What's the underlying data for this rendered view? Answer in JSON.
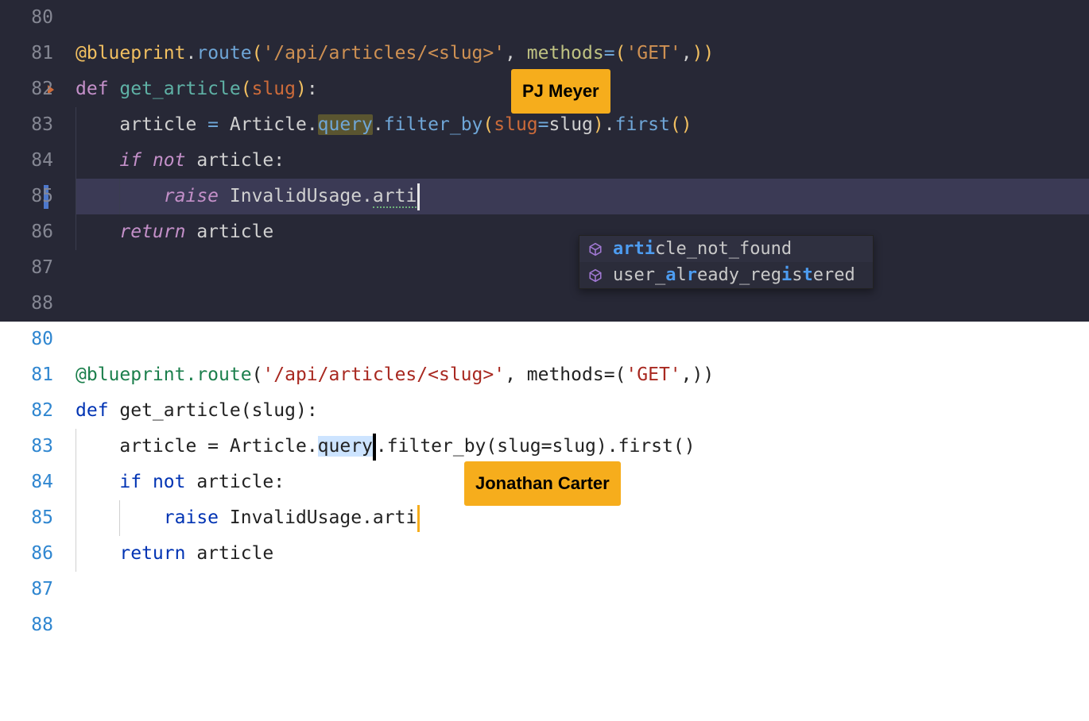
{
  "dark": {
    "collaborator_name": "PJ Meyer",
    "line_numbers": [
      "80",
      "81",
      "82",
      "83",
      "84",
      "85",
      "86",
      "87",
      "88"
    ],
    "code": {
      "l81": {
        "decorator": "@blueprint",
        "dot1": ".",
        "route": "route",
        "paren_o": "(",
        "str1": "'/api/articles/<slug>'",
        "comma": ", ",
        "methods_kw": "methods",
        "eq": "=",
        "paren_o2": "(",
        "str2": "'GET'",
        "comma2": ",",
        "paren_c2": ")",
        "paren_c": ")"
      },
      "l82": {
        "def": "def ",
        "name": "get_article",
        "paren_o": "(",
        "param": "slug",
        "paren_c": ")",
        "colon": ":"
      },
      "l83": {
        "indent": "    ",
        "var": "article ",
        "eq": "= ",
        "cls": "Article",
        "dot1": ".",
        "query": "query",
        "dot2": ".",
        "filter_by": "filter_by",
        "paren_o": "(",
        "argname": "slug",
        "eq2": "=",
        "argval": "slug",
        "paren_c": ")",
        "dot3": ".",
        "first": "first",
        "paren_o2": "(",
        "paren_c2": ")"
      },
      "l84": {
        "indent": "    ",
        "if": "if ",
        "not": "not ",
        "var": "article",
        "colon": ":"
      },
      "l85": {
        "indent": "        ",
        "raise": "raise ",
        "cls": "InvalidUsage",
        "dot": ".",
        "attr": "arti"
      },
      "l86": {
        "indent": "    ",
        "return": "return ",
        "var": "article"
      }
    },
    "autocomplete": {
      "items": [
        {
          "pre": "arti",
          "mid": "cle_not_found"
        },
        {
          "pretext": "user_",
          "hl1": "a",
          "t1": "l",
          "hl2": "r",
          "t2": "eady_reg",
          "hl3": "i",
          "t3": "s",
          "hl4": "t",
          "t4": "ered"
        }
      ]
    }
  },
  "light": {
    "collaborator_name": "Jonathan Carter",
    "line_numbers": [
      "80",
      "81",
      "82",
      "83",
      "84",
      "85",
      "86",
      "87",
      "88"
    ],
    "code": {
      "l81": {
        "decorator": "@blueprint.route",
        "paren_o": "(",
        "str1": "'/api/articles/<slug>'",
        "comma": ", ",
        "methods_kw": "methods",
        "eq": "=",
        "paren_o2": "(",
        "str2": "'GET'",
        "comma2": ",",
        "paren_c2": ")",
        "paren_c": ")"
      },
      "l82": {
        "def": "def ",
        "name": "get_article",
        "paren_o": "(",
        "param": "slug",
        "paren_c": ")",
        "colon": ":"
      },
      "l83": {
        "indent": "    ",
        "var": "article ",
        "eq": "= ",
        "cls": "Article",
        "dot1": ".",
        "query": "query",
        "dot2": ".",
        "filter_by": "filter_by",
        "paren_o": "(",
        "argname": "slug",
        "eq2": "=",
        "argval": "slug",
        "paren_c": ")",
        "dot3": ".",
        "first": "first",
        "paren_o2": "(",
        "paren_c2": ")"
      },
      "l84": {
        "indent": "    ",
        "if": "if ",
        "not": "not ",
        "var": "article",
        "colon": ":"
      },
      "l85": {
        "indent": "        ",
        "raise": "raise ",
        "cls": "InvalidUsage",
        "dot": ".",
        "attr": "arti"
      },
      "l86": {
        "indent": "    ",
        "return": "return ",
        "var": "article"
      }
    }
  }
}
